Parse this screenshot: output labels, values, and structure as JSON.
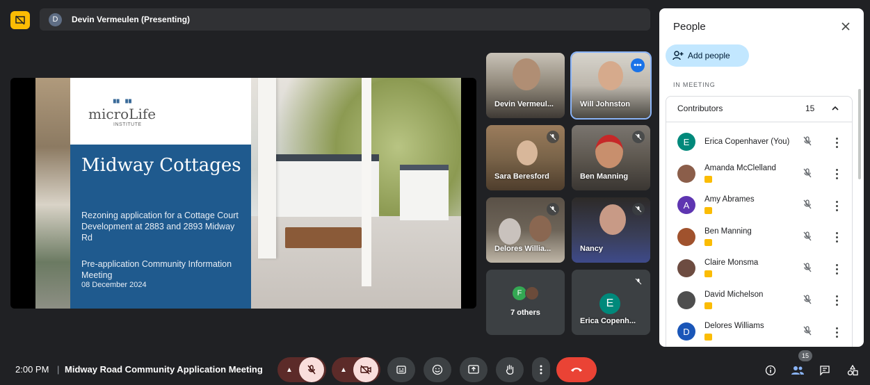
{
  "presenting": {
    "initial": "D",
    "name": "Devin Vermeulen (Presenting)"
  },
  "slide": {
    "logo_text": "microLife",
    "logo_sub": "INSTITUTE",
    "title": "Midway Cottages",
    "subtitle": "Rezoning application for a Cottage Court Development at 2883 and 2893 Midway Rd",
    "meeting": "Pre-application Community Information Meeting",
    "date": "08 December 2024"
  },
  "tiles": {
    "devin": "Devin Vermeul...",
    "will": "Will Johnston",
    "will_more": "•••",
    "sara": "Sara Beresford",
    "ben": "Ben Manning",
    "delores": "Delores Willia...",
    "nancy": "Nancy",
    "others_initial": "F",
    "others_label": "7 others",
    "erica_initial": "E",
    "erica": "Erica Copenh..."
  },
  "bottom": {
    "time": "2:00 PM",
    "separator": "|",
    "meeting_title": "Midway Road Community Application Meeting",
    "people_badge": "15"
  },
  "panel": {
    "title": "People",
    "add_people": "Add people",
    "in_meeting": "IN MEETING",
    "group_label": "Contributors",
    "group_count": "15",
    "participants": [
      {
        "initial": "E",
        "name": "Erica Copenhaver (You)",
        "color": "#00897b"
      },
      {
        "initial": "",
        "name": "Amanda McClelland",
        "color": "#8b5e4a"
      },
      {
        "initial": "A",
        "name": "Amy Abrames",
        "color": "#5e35b1"
      },
      {
        "initial": "",
        "name": "Ben Manning",
        "color": "#a0522d"
      },
      {
        "initial": "",
        "name": "Claire Monsma",
        "color": "#6d4c41"
      },
      {
        "initial": "",
        "name": "David Michelson",
        "color": "#4e4e4e"
      },
      {
        "initial": "D",
        "name": "Delores Williams",
        "color": "#1a56b8"
      }
    ]
  },
  "colors": {
    "accent": "#8ab4f8",
    "hangup": "#ea4335",
    "presenting": "#fbbc04",
    "add_people_bg": "#c2e7ff"
  }
}
